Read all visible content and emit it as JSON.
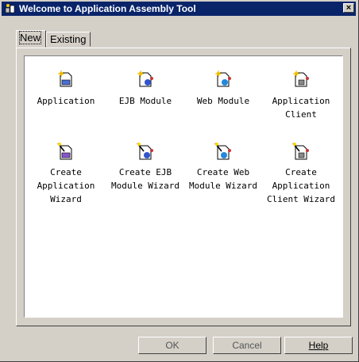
{
  "window": {
    "title": "Welcome to Application Assembly Tool",
    "close_glyph": "×"
  },
  "tabs": [
    {
      "label": "New",
      "active": true
    },
    {
      "label": "Existing",
      "active": false
    }
  ],
  "items": [
    {
      "label": "Application",
      "icon": "application-icon"
    },
    {
      "label": "EJB Module",
      "icon": "ejb-module-icon"
    },
    {
      "label": "Web Module",
      "icon": "web-module-icon"
    },
    {
      "label": "Application\nClient",
      "icon": "application-client-icon"
    },
    {
      "label": "Create\nApplication\nWizard",
      "icon": "application-wizard-icon"
    },
    {
      "label": "Create EJB\nModule Wizard",
      "icon": "ejb-module-wizard-icon"
    },
    {
      "label": "Create Web\nModule Wizard",
      "icon": "web-module-wizard-icon"
    },
    {
      "label": "Create\nApplication\nClient Wizard",
      "icon": "application-client-wizard-icon"
    }
  ],
  "buttons": {
    "ok": "OK",
    "cancel": "Cancel",
    "help": "Help"
  },
  "colors": {
    "titlebar": "#0a246a",
    "face": "#d4d0c8",
    "content": "#ffffff"
  }
}
